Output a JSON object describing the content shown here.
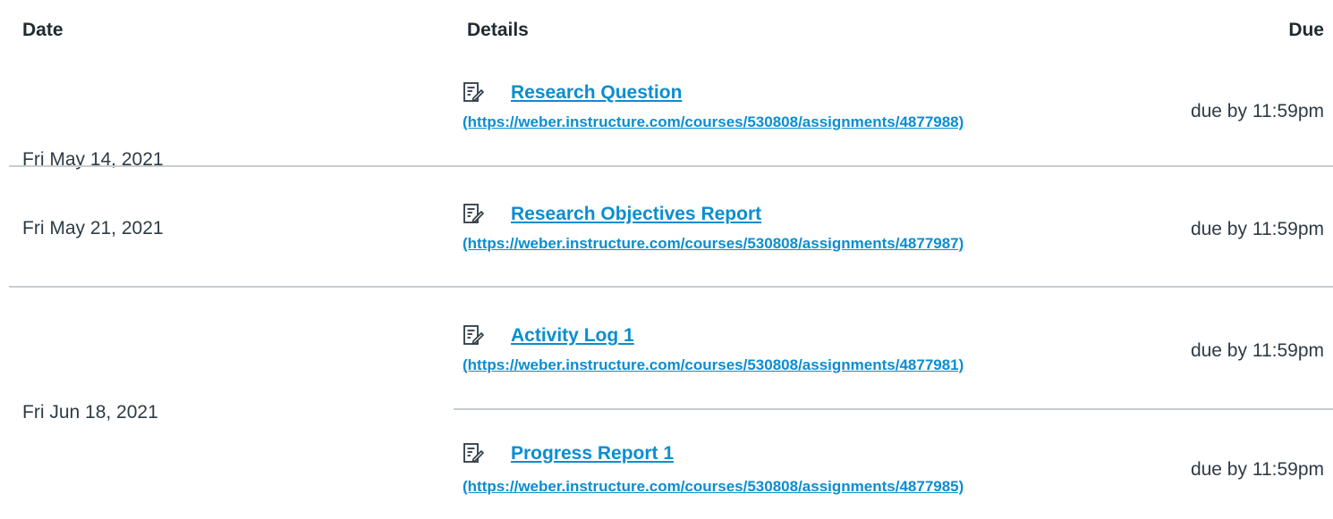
{
  "header": {
    "date": "Date",
    "details": "Details",
    "due": "Due"
  },
  "rows": [
    {
      "date": "Fri May 14, 2021",
      "assignments": [
        {
          "icon": "assignment-icon",
          "title": "Research Question",
          "url": "(https://weber.instructure.com/courses/530808/assignments/4877988)",
          "due": "due by 11:59pm"
        }
      ]
    },
    {
      "date": "Fri May 21, 2021",
      "assignments": [
        {
          "icon": "assignment-icon",
          "title": "Research Objectives Report",
          "url": "(https://weber.instructure.com/courses/530808/assignments/4877987)",
          "due": "due by 11:59pm"
        }
      ]
    },
    {
      "date": "Fri Jun 18, 2021",
      "assignments": [
        {
          "icon": "assignment-icon",
          "title": "Activity Log 1",
          "url": "(https://weber.instructure.com/courses/530808/assignments/4877981)",
          "due": "due by 11:59pm"
        },
        {
          "icon": "assignment-icon",
          "title": "Progress Report 1",
          "url": "(https://weber.instructure.com/courses/530808/assignments/4877985)",
          "due": "due by 11:59pm"
        }
      ]
    }
  ],
  "colors": {
    "link": "#0b8dd0",
    "text": "#2d3b45",
    "divider": "#c7cdd1"
  }
}
